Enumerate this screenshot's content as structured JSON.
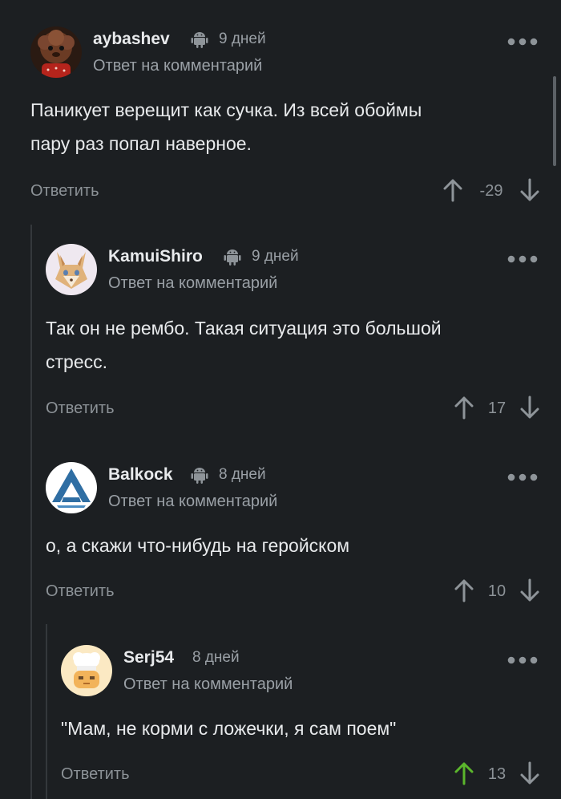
{
  "comments": [
    {
      "author": "aybashev",
      "time": "9 дней",
      "reply_label": "Ответ на комментарий",
      "text_lines": [
        "Паникует верещит как сучка. Из всей обоймы",
        "пару раз попал наверное."
      ],
      "action_label": "Ответить",
      "rating": "-29",
      "upvoted": false,
      "avatar_icon": "brown-dog-avatar-icon"
    },
    {
      "author": "KamuiShiro",
      "time": "9 дней",
      "reply_label": "Ответ на комментарий",
      "text_lines": [
        "Так он не рембо. Такая ситуация это большой",
        "стресс."
      ],
      "action_label": "Ответить",
      "rating": "17",
      "upvoted": false,
      "avatar_icon": "fox-avatar-icon"
    },
    {
      "author": "Balkock",
      "time": "8 дней",
      "reply_label": "Ответ на комментарий",
      "text_lines": [
        "о, а скажи что-нибудь на геройском"
      ],
      "action_label": "Ответить",
      "rating": "10",
      "upvoted": false,
      "avatar_icon": "triangle-logo-avatar-icon"
    },
    {
      "author": "Serj54",
      "time": "8 дней",
      "reply_label": "Ответ на комментарий",
      "text_lines": [
        "\"Мам, не корми с ложечки, я сам поем\""
      ],
      "action_label": "Ответить",
      "rating": "13",
      "upvoted": true,
      "avatar_icon": "chef-avatar-icon"
    }
  ],
  "colors": {
    "background": "#1c1f22",
    "text": "#e8eaec",
    "muted": "#9aa0a6",
    "upvote_active": "#5bb62c",
    "thread_line": "#34383c"
  }
}
